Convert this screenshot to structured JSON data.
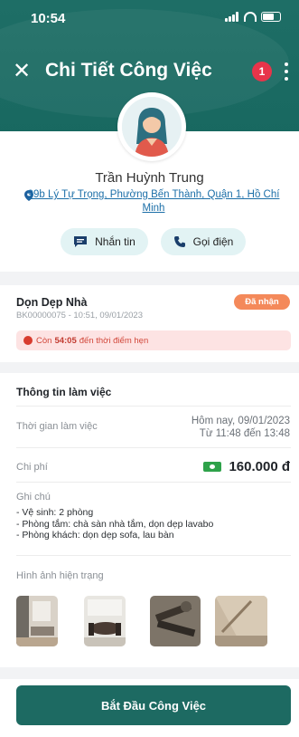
{
  "status_bar": {
    "time": "10:54"
  },
  "nav": {
    "title": "Chi Tiết Công Việc",
    "badge_count": "1"
  },
  "profile": {
    "name": "Trần Huỳnh Trung",
    "address": "99b Lý Tự Trọng, Phường Bến Thành, Quận 1, Hồ Chí Minh",
    "message_label": "Nhắn tin",
    "call_label": "Gọi điện"
  },
  "job": {
    "title": "Dọn Dẹp Nhà",
    "code": "BK00000075 - 10:51, 09/01/2023",
    "status": "Đã nhận",
    "countdown_prefix": "Còn",
    "countdown_time": "54:05",
    "countdown_suffix": "đến thời điểm hẹn"
  },
  "info": {
    "title": "Thông tin làm việc",
    "time_label": "Thời gian làm việc",
    "time_line1": "Hôm nay, 09/01/2023",
    "time_line2": "Từ 11:48 đến 13:48",
    "cost_label": "Chi phí",
    "cost_value": "160.000 đ",
    "notes_label": "Ghi chú",
    "notes": [
      "- Vệ sinh: 2 phòng",
      "- Phòng tắm: chà sàn nhà tắm, dọn dẹp lavabo",
      "- Phòng khách: dọn dẹp sofa, lau bàn"
    ],
    "photos_label": "Hình ảnh hiện trạng"
  },
  "bottom": {
    "start_label": "Bắt Đầu Công Việc"
  },
  "colors": {
    "brand": "#1d6a62",
    "status": "#f4895a",
    "alert": "#d2483b",
    "badge": "#e8344a"
  }
}
